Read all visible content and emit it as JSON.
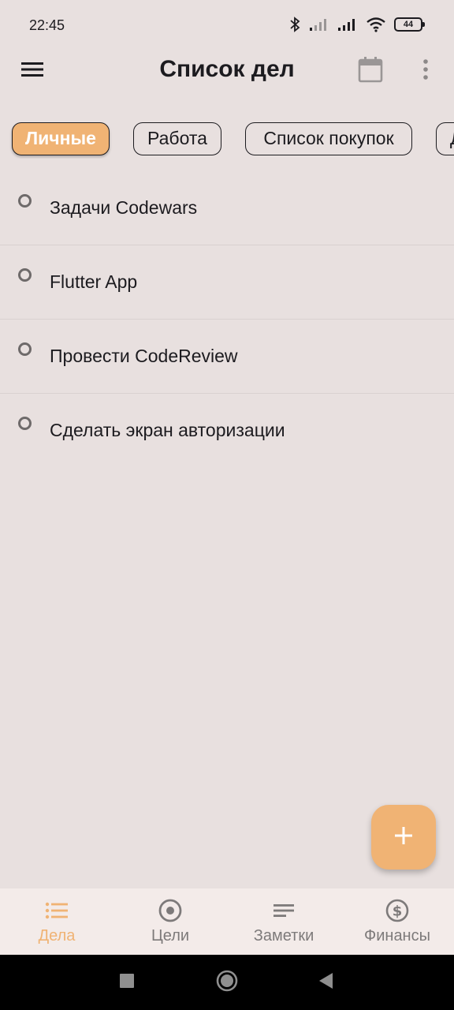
{
  "status_bar": {
    "time": "22:45",
    "battery": "44",
    "icons": [
      "bluetooth-icon",
      "signal-icon",
      "signal-icon",
      "wifi-icon",
      "battery-icon"
    ]
  },
  "app_bar": {
    "title": "Список дел",
    "left_icon": "menu-icon",
    "right_icons": [
      "calendar-icon",
      "more-vert-icon"
    ]
  },
  "categories": [
    {
      "label": "Личные",
      "selected": true
    },
    {
      "label": "Работа",
      "selected": false
    },
    {
      "label": "Список покупок",
      "selected": false
    },
    {
      "label": "Д",
      "selected": false
    }
  ],
  "todos": [
    {
      "title": "Задачи Codewars"
    },
    {
      "title": "Flutter App"
    },
    {
      "title": "Провести CodeReview"
    },
    {
      "title": "Сделать экран авторизации"
    }
  ],
  "fab": {
    "icon": "plus-icon"
  },
  "bottom_nav": [
    {
      "label": "Дела",
      "icon": "list-icon",
      "active": true
    },
    {
      "label": "Цели",
      "icon": "target-icon",
      "active": false
    },
    {
      "label": "Заметки",
      "icon": "notes-icon",
      "active": false
    },
    {
      "label": "Финансы",
      "icon": "dollar-icon",
      "active": false
    }
  ],
  "colors": {
    "accent": "#f0b374",
    "background": "#e8e0df",
    "nav_background": "#f3ebe9",
    "inactive": "#7d7a7a"
  }
}
